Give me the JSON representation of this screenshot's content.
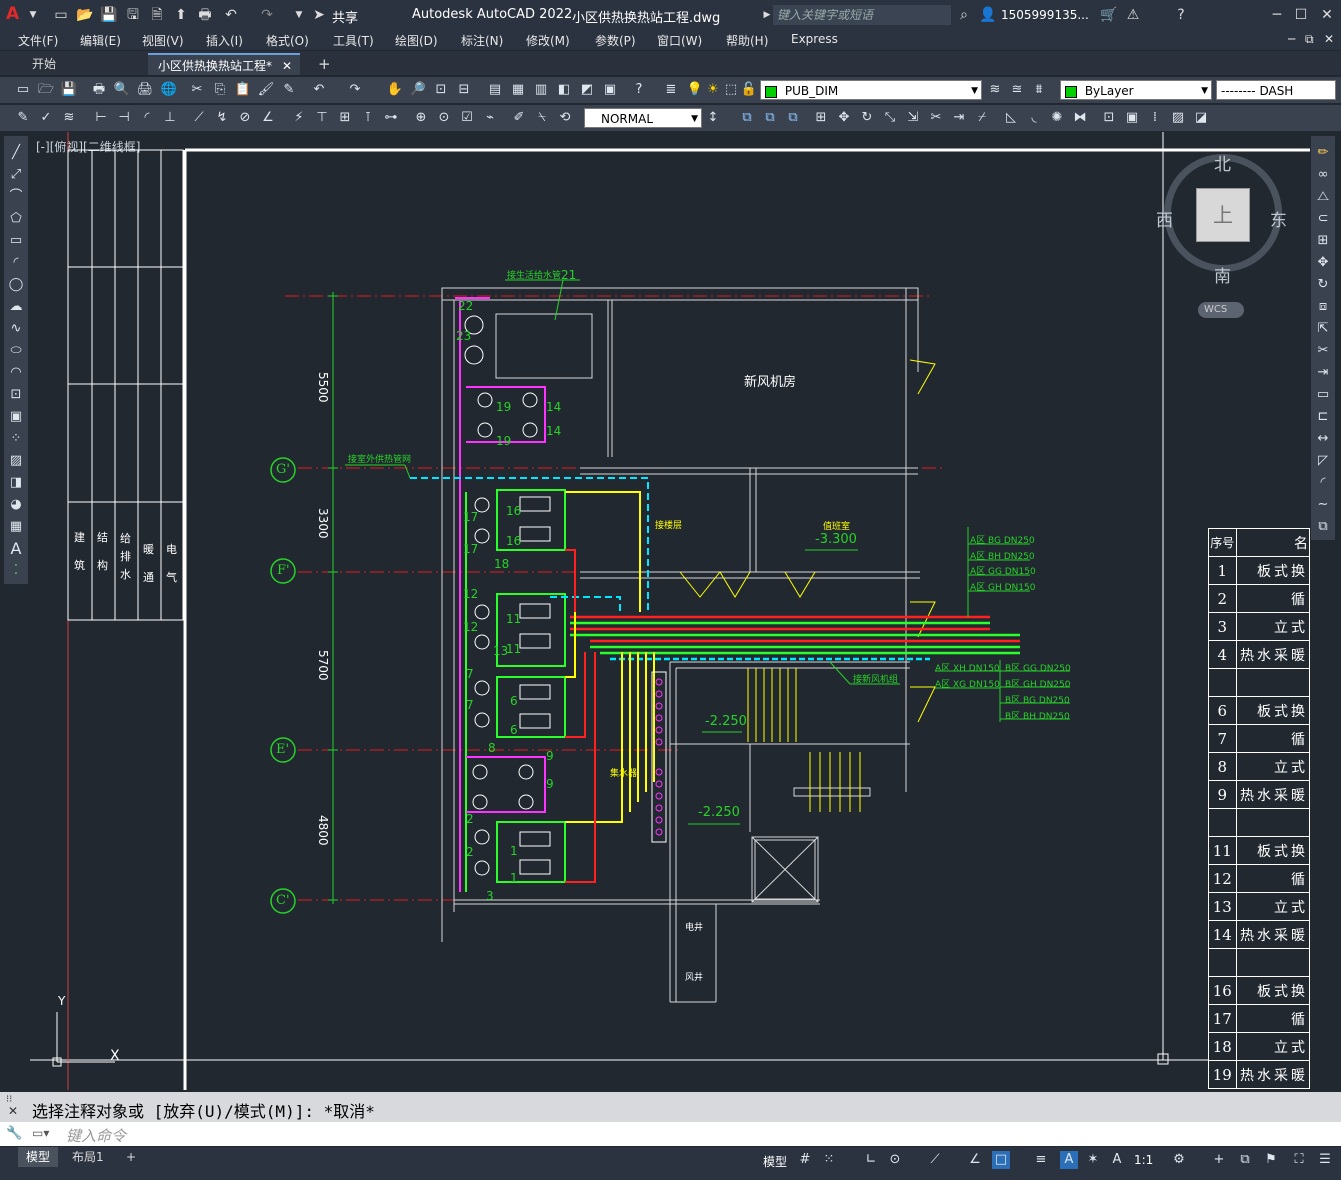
{
  "app": {
    "logo": "A",
    "title": "Autodesk AutoCAD 2022",
    "file": "小区供热换热站工程.dwg",
    "share": "共享",
    "search_placeholder": "键入关键字或短语",
    "user": "1505999135...",
    "accent": "#d9242b"
  },
  "menu": [
    "文件(F)",
    "编辑(E)",
    "视图(V)",
    "插入(I)",
    "格式(O)",
    "工具(T)",
    "绘图(D)",
    "标注(N)",
    "修改(M)",
    "参数(P)",
    "窗口(W)",
    "帮助(H)",
    "Express"
  ],
  "tabs": {
    "start": "开始",
    "doc": "小区供热换热站工程*",
    "add": "+"
  },
  "props": {
    "layer": "PUB_DIM",
    "color": "ByLayer",
    "linetype": "-------- DASH",
    "textstyle": "NORMAL"
  },
  "viewport_label": "[-][俯视][二维线框]",
  "viewcube": {
    "north": "北",
    "south": "南",
    "east": "东",
    "west": "西",
    "top": "上",
    "wcs": "WCS"
  },
  "drawing": {
    "room_xinfeng": "新风机房",
    "room_zhiban": "值班室",
    "elev_1": "-3.300",
    "elev_2": "-2.250",
    "elev_3": "-2.250",
    "pipe_label_1": "接生活给水管",
    "pipe_label_2": "接室外供热管网",
    "pipe_label_3": "接新风机组",
    "pipe_label_4": "接楼层",
    "pipe_label_5": "集水器",
    "label_21": "21",
    "room_small_1": "电井",
    "room_small_2": "风井",
    "axis_labels": [
      "G'",
      "F'",
      "E'",
      "C'"
    ],
    "dims": [
      "5500",
      "3300",
      "5700",
      "4800"
    ],
    "pipe_tags_a": [
      "A区 BG DN250",
      "A区 BH DN250",
      "A区 GG DN150",
      "A区 GH DN150"
    ],
    "pipe_tags_b1": [
      "A区 XH DN150",
      "A区 XG DN150"
    ],
    "pipe_tags_b2": [
      "B区 GG DN250",
      "B区 GH DN250",
      "B区 BG DN250",
      "B区 BH DN250"
    ],
    "equip_nums": [
      "22",
      "23",
      "19",
      "14",
      "19",
      "14",
      "17",
      "16",
      "17",
      "16",
      "18",
      "12",
      "11",
      "12",
      "13",
      "11",
      "7",
      "6",
      "7",
      "6",
      "8",
      "9",
      "9",
      "2",
      "1",
      "2",
      "1",
      "3"
    ],
    "ucs_y": "Y",
    "ucs_x": "X"
  },
  "title_block": {
    "left_cols": [
      "建筑",
      "结构",
      "给排水",
      "暖通",
      "电气"
    ],
    "table_header": [
      "序号",
      "名"
    ],
    "rows": [
      {
        "n": "1",
        "t": "板式换"
      },
      {
        "n": "2",
        "t": "循"
      },
      {
        "n": "3",
        "t": "立式"
      },
      {
        "n": "4",
        "t": "热水采暖"
      },
      {
        "n": "",
        "t": ""
      },
      {
        "n": "6",
        "t": "板式换"
      },
      {
        "n": "7",
        "t": "循"
      },
      {
        "n": "8",
        "t": "立式"
      },
      {
        "n": "9",
        "t": "热水采暖"
      },
      {
        "n": "",
        "t": ""
      },
      {
        "n": "11",
        "t": "板式换"
      },
      {
        "n": "12",
        "t": "循"
      },
      {
        "n": "13",
        "t": "立式"
      },
      {
        "n": "14",
        "t": "热水采暖"
      },
      {
        "n": "",
        "t": ""
      },
      {
        "n": "16",
        "t": "板式换"
      },
      {
        "n": "17",
        "t": "循"
      },
      {
        "n": "18",
        "t": "立式"
      },
      {
        "n": "19",
        "t": "热水采暖"
      }
    ]
  },
  "command": {
    "history": "选择注释对象或 [放弃(U)/模式(M)]: *取消*",
    "placeholder": "键入命令"
  },
  "status": {
    "model_tab": "模型",
    "layout_tab": "布局1",
    "model_btn": "模型",
    "scale": "1:1"
  }
}
